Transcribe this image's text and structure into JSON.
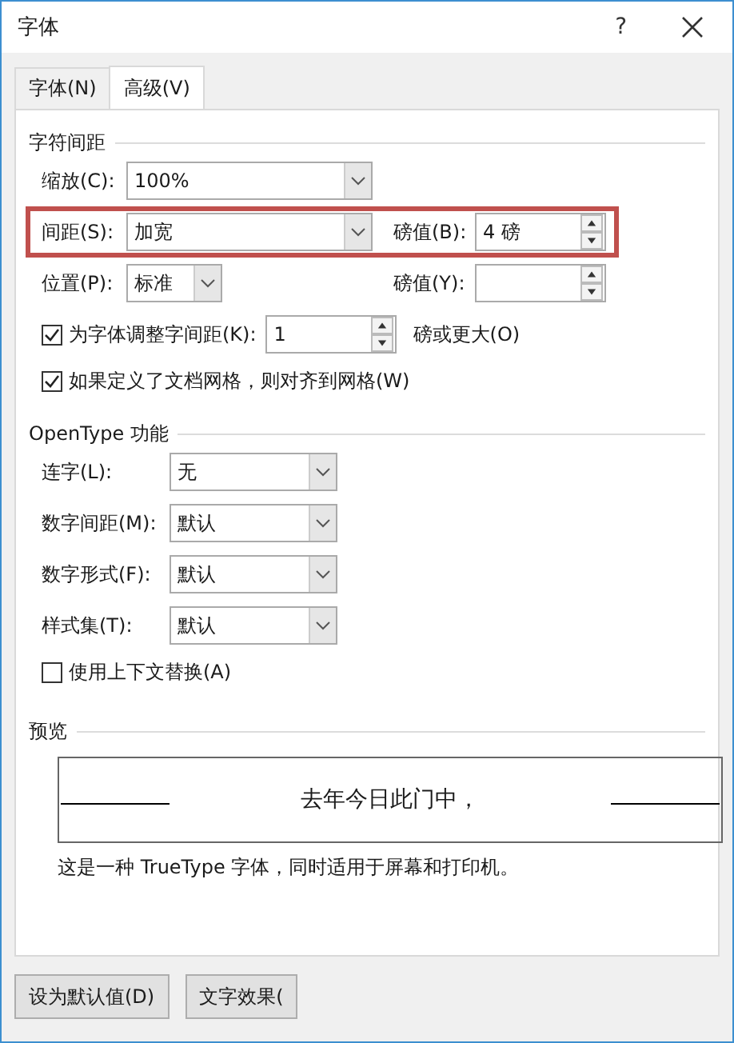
{
  "window": {
    "title": "字体",
    "help": "?"
  },
  "tabs": [
    {
      "label": "字体(N)",
      "selected": false
    },
    {
      "label": "高级(V)",
      "selected": true
    }
  ],
  "character_spacing": {
    "heading": "字符间距",
    "scale": {
      "label": "缩放(C):",
      "value": "100%"
    },
    "spacing": {
      "label": "间距(S):",
      "value": "加宽",
      "highlighted": true
    },
    "spacing_by": {
      "label": "磅值(B):",
      "value": "4 磅"
    },
    "position": {
      "label": "位置(P):",
      "value": "标准"
    },
    "position_by": {
      "label": "磅值(Y):"
    },
    "kerning": {
      "label": "为字体调整字间距(K):",
      "checked": true,
      "value": "1",
      "suffix": "磅或更大(O)"
    },
    "snap_to_grid": {
      "label": "如果定义了文档网格，则对齐到网格(W)",
      "checked": true
    }
  },
  "opentype": {
    "heading": "OpenType 功能",
    "options": [
      {
        "label": "连字(L):",
        "value": "无"
      },
      {
        "label": "数字间距(M):",
        "value": "默认"
      },
      {
        "label": "数字形式(F):",
        "value": "默认"
      },
      {
        "label": "样式集(T):",
        "value": "默认"
      }
    ],
    "contextual_alternates": {
      "label": "使用上下文替换(A)",
      "checked": false
    }
  },
  "preview": {
    "heading": "预览",
    "sample": "去年今日此门中，",
    "description": "这是一种 TrueType 字体，同时适用于屏幕和打印机。"
  },
  "buttons": [
    "设为默认值(D)",
    "文字效果("
  ]
}
